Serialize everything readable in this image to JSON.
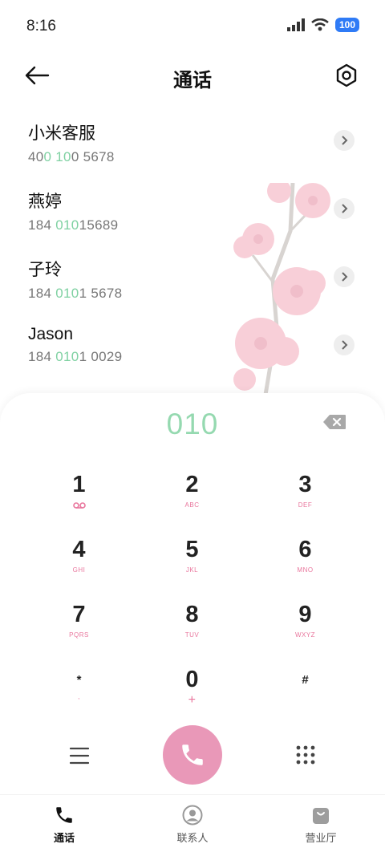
{
  "status_bar": {
    "time": "8:16",
    "battery": "100"
  },
  "header": {
    "title": "通话"
  },
  "contacts": [
    {
      "name": "小米客服",
      "number_parts": [
        "40",
        "0 10",
        "0 5678"
      ]
    },
    {
      "name": "燕婷",
      "number_parts": [
        "184 ",
        "010",
        "15689"
      ]
    },
    {
      "name": "子玲",
      "number_parts": [
        "184 ",
        "010",
        "1 5678"
      ]
    },
    {
      "name": "Jason",
      "number_parts": [
        "184 ",
        "010",
        "1 0029"
      ]
    }
  ],
  "dialpad": {
    "input": "010",
    "keys": [
      {
        "digit": "1",
        "letters": ""
      },
      {
        "digit": "2",
        "letters": "ABC"
      },
      {
        "digit": "3",
        "letters": "DEF"
      },
      {
        "digit": "4",
        "letters": "GHI"
      },
      {
        "digit": "5",
        "letters": "JKL"
      },
      {
        "digit": "6",
        "letters": "MNO"
      },
      {
        "digit": "7",
        "letters": "PQRS"
      },
      {
        "digit": "8",
        "letters": "TUV"
      },
      {
        "digit": "9",
        "letters": "WXYZ"
      },
      {
        "digit": "*",
        "letters": ","
      },
      {
        "digit": "0",
        "letters": "+"
      },
      {
        "digit": "#",
        "letters": ""
      }
    ]
  },
  "bottom_nav": [
    {
      "label": "通话",
      "icon": "phone-icon",
      "active": true
    },
    {
      "label": "联系人",
      "icon": "contacts-icon",
      "active": false
    },
    {
      "label": "营业厅",
      "icon": "store-bag-icon",
      "active": false
    }
  ],
  "colors": {
    "accent_green": "#95d9b0",
    "accent_pink": "#e998b8",
    "battery_blue": "#2f7bf6"
  }
}
